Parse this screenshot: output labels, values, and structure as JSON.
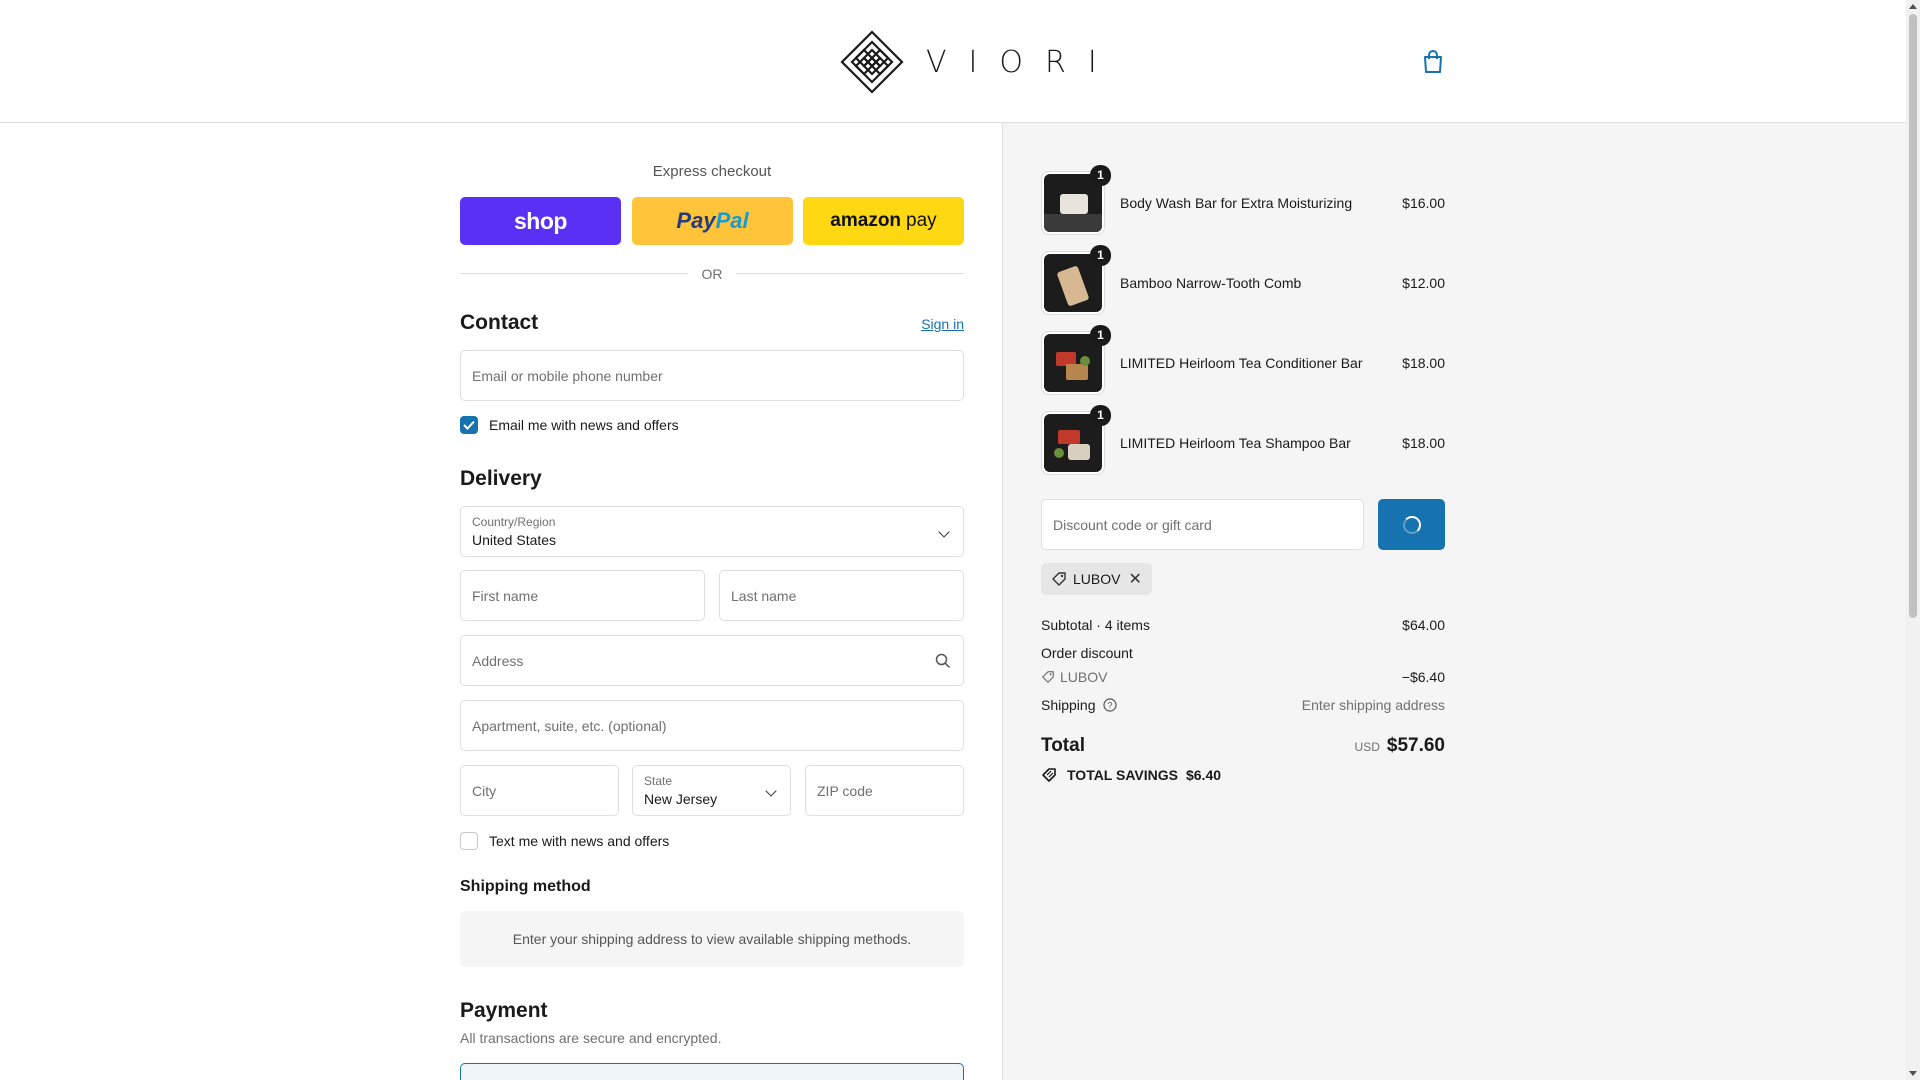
{
  "header": {
    "brand": "VIORI"
  },
  "express": {
    "title": "Express checkout",
    "shop_label": "shop",
    "paypal_pay": "Pay",
    "paypal_pal": "Pal",
    "amazon_label": "amazon",
    "amazon_pay": "pay",
    "or_label": "OR"
  },
  "contact": {
    "heading": "Contact",
    "sign_in": "Sign in",
    "email_placeholder": "Email or mobile phone number",
    "news_checkbox_label": "Email me with news and offers",
    "news_checked": true
  },
  "delivery": {
    "heading": "Delivery",
    "country_label": "Country/Region",
    "country_value": "United States",
    "first_name_placeholder": "First name",
    "last_name_placeholder": "Last name",
    "address_placeholder": "Address",
    "apartment_placeholder": "Apartment, suite, etc. (optional)",
    "city_placeholder": "City",
    "state_label": "State",
    "state_value": "New Jersey",
    "zip_placeholder": "ZIP code",
    "text_checkbox_label": "Text me with news and offers",
    "text_checked": false
  },
  "shipping_method": {
    "heading": "Shipping method",
    "message": "Enter your shipping address to view available shipping methods."
  },
  "payment": {
    "heading": "Payment",
    "subtitle": "All transactions are secure and encrypted."
  },
  "order": {
    "items": [
      {
        "name": "Body Wash Bar for Extra Moisturizing",
        "price": "$16.00",
        "qty": "1"
      },
      {
        "name": "Bamboo Narrow-Tooth Comb",
        "price": "$12.00",
        "qty": "1"
      },
      {
        "name": "LIMITED Heirloom Tea Conditioner Bar",
        "price": "$18.00",
        "qty": "1"
      },
      {
        "name": "LIMITED Heirloom Tea Shampoo Bar",
        "price": "$18.00",
        "qty": "1"
      }
    ],
    "discount_placeholder": "Discount code or gift card",
    "applied_code": "LUBOV",
    "subtotal_label": "Subtotal · 4 items",
    "subtotal_value": "$64.00",
    "order_discount_label": "Order discount",
    "discount_code": "LUBOV",
    "discount_value": "−$6.40",
    "shipping_label": "Shipping",
    "shipping_value": "Enter shipping address",
    "total_label": "Total",
    "currency": "USD",
    "total_value": "$57.60",
    "savings_label": "TOTAL SAVINGS",
    "savings_value": "$6.40"
  },
  "colors": {
    "accent": "#1773b0",
    "shop": "#5a31f4",
    "paypal": "#ffc439",
    "amazon": "#ffd814"
  }
}
